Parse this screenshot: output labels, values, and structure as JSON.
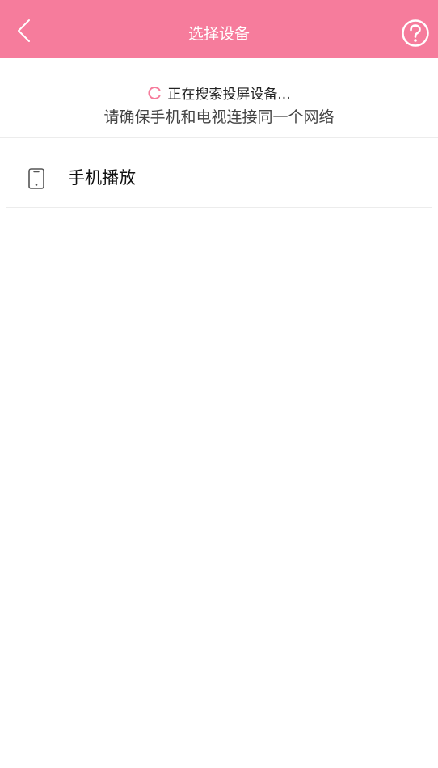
{
  "header": {
    "title": "选择设备",
    "back_icon": "chevron-left-icon",
    "help_icon": "question-circle-icon",
    "background_color": "#f67c9c"
  },
  "status": {
    "searching_text": "正在搜索投屏设备...",
    "hint_text": "请确保手机和电视连接同一个网络",
    "spinner_icon": "loading-spinner-icon",
    "spinner_color": "#f67c9c"
  },
  "devices": [
    {
      "label": "手机播放",
      "icon": "phone-icon"
    }
  ]
}
